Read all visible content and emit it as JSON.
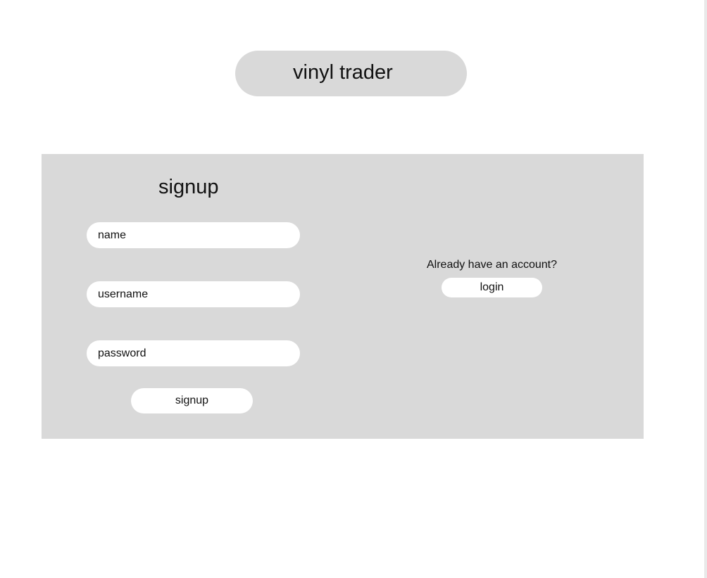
{
  "app": {
    "title": "vinyl trader"
  },
  "signup": {
    "heading": "signup",
    "fields": {
      "name_placeholder": "name",
      "username_placeholder": "username",
      "password_placeholder": "password"
    },
    "submit_label": "signup"
  },
  "login": {
    "prompt": "Already have an account?",
    "button_label": "login"
  },
  "colors": {
    "background": "#ffffff",
    "panel": "#d9d9d9",
    "pill": "#d9d9d9",
    "input": "#ffffff",
    "text": "#111111"
  }
}
